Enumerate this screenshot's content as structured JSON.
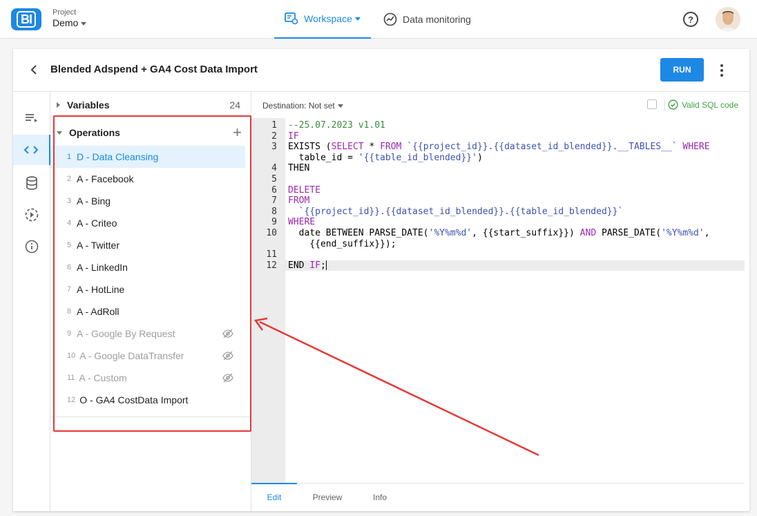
{
  "app": {
    "logo_text": "BI"
  },
  "project": {
    "label": "Project",
    "name": "Demo"
  },
  "nav": {
    "workspace": "Workspace",
    "monitoring": "Data monitoring"
  },
  "header": {
    "help_glyph": "?"
  },
  "card": {
    "title": "Blended Adspend + GA4 Cost Data Import",
    "run_label": "RUN"
  },
  "side": {
    "variables": {
      "title": "Variables",
      "count": "24"
    },
    "operations": {
      "title": "Operations",
      "add": "+"
    },
    "items": [
      {
        "num": "1",
        "label": "D - Data Cleansing",
        "state": "active"
      },
      {
        "num": "2",
        "label": "A - Facebook",
        "state": "normal"
      },
      {
        "num": "3",
        "label": "A - Bing",
        "state": "normal"
      },
      {
        "num": "4",
        "label": "A - Criteo",
        "state": "normal"
      },
      {
        "num": "5",
        "label": "A - Twitter",
        "state": "normal"
      },
      {
        "num": "6",
        "label": "A - LinkedIn",
        "state": "normal"
      },
      {
        "num": "7",
        "label": "A - HotLine",
        "state": "normal"
      },
      {
        "num": "8",
        "label": "A - AdRoll",
        "state": "normal"
      },
      {
        "num": "9",
        "label": "A - Google By Request",
        "state": "disabled"
      },
      {
        "num": "10",
        "label": "A - Google DataTransfer",
        "state": "disabled"
      },
      {
        "num": "11",
        "label": "A - Custom",
        "state": "disabled"
      },
      {
        "num": "12",
        "label": "O - GA4 CostData Import",
        "state": "normal"
      }
    ]
  },
  "editor": {
    "destination": "Destination: Not set",
    "valid": "Valid SQL code",
    "tabs": [
      "Edit",
      "Preview",
      "Info"
    ],
    "lines": [
      {
        "num": "1",
        "text": "--25.07.2023 v1.01"
      },
      {
        "num": "2",
        "text": "IF"
      },
      {
        "num": "3",
        "text": "EXISTS (SELECT * FROM `{{project_id}}.{{dataset_id_blended}}.__TABLES__` WHERE"
      },
      {
        "num": "",
        "text": "  table_id = '{{table_id_blended}}')"
      },
      {
        "num": "4",
        "text": "THEN"
      },
      {
        "num": "5",
        "text": ""
      },
      {
        "num": "6",
        "text": "DELETE"
      },
      {
        "num": "7",
        "text": "FROM"
      },
      {
        "num": "8",
        "text": "  `{{project_id}}.{{dataset_id_blended}}.{{table_id_blended}}`"
      },
      {
        "num": "9",
        "text": "WHERE"
      },
      {
        "num": "10",
        "text": "  date BETWEEN PARSE_DATE('%Y%m%d', {{start_suffix}}) AND PARSE_DATE('%Y%m%d',"
      },
      {
        "num": "",
        "text": "    {{end_suffix}});"
      },
      {
        "num": "11",
        "text": ""
      },
      {
        "num": "12",
        "text": "END IF;"
      }
    ]
  },
  "colors": {
    "accent": "#1e88e5",
    "valid": "#43a047",
    "annotation": "#e53935"
  }
}
